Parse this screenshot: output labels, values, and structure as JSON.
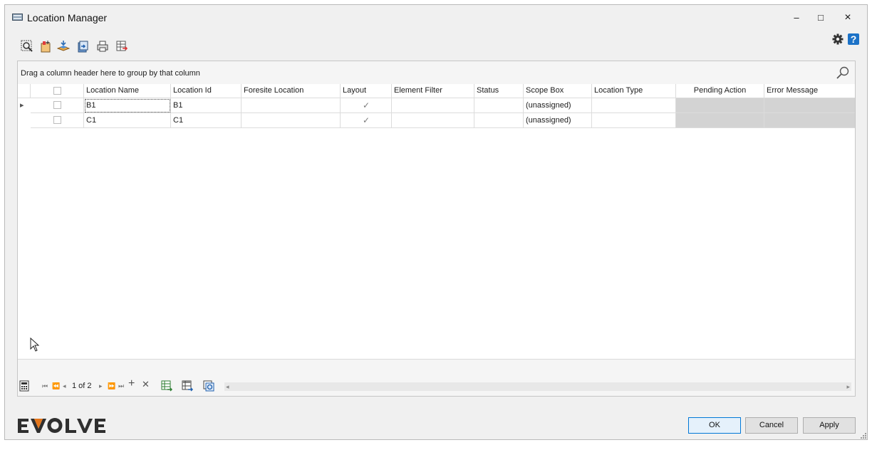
{
  "window": {
    "title": "Location Manager",
    "minimize": "–",
    "maximize": "□",
    "close": "×"
  },
  "help_glyph": "?",
  "toolbar": {
    "icons": [
      "zoom-icon",
      "new-location-icon",
      "import-icon",
      "export-icon",
      "print-icon",
      "export-grid-icon"
    ]
  },
  "grid": {
    "group_hint": "Drag a column header here to group by that column",
    "columns": [
      "Location Name",
      "Location Id",
      "Foresite Location",
      "Layout",
      "Element Filter",
      "Status",
      "Scope Box",
      "Location Type",
      "Pending Action",
      "Error Message"
    ],
    "rows": [
      {
        "location_name": "B1",
        "location_id": "B1",
        "foresite_location": "",
        "layout": "✓",
        "element_filter": "",
        "status": "",
        "scope_box": "(unassigned)",
        "location_type": "",
        "pending_action": "",
        "error_message": ""
      },
      {
        "location_name": "C1",
        "location_id": "C1",
        "foresite_location": "",
        "layout": "✓",
        "element_filter": "",
        "status": "",
        "scope_box": "(unassigned)",
        "location_type": "",
        "pending_action": "",
        "error_message": ""
      }
    ],
    "row_indicator": "▸"
  },
  "navigator": {
    "first": "⏮",
    "prev_page": "⏪",
    "prev": "◂",
    "page_text": "1 of 2",
    "next": "▸",
    "next_page": "⏩",
    "last": "⏭",
    "add": "+",
    "delete": "✕",
    "scroll_left": "◂",
    "scroll_right": "▸"
  },
  "logo_text": "EVOLVE",
  "buttons": {
    "ok": "OK",
    "cancel": "Cancel",
    "apply": "Apply"
  },
  "colors": {
    "accent": "#1c72c7",
    "logo_accent": "#e4761b",
    "pending_gray": "#d3d3d3"
  }
}
